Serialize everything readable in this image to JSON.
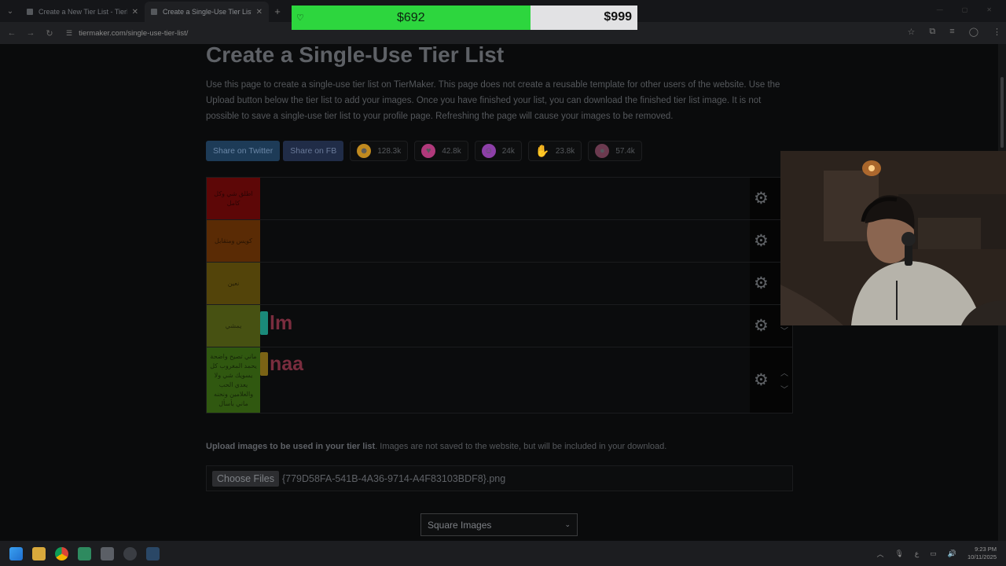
{
  "browser": {
    "tabs": [
      {
        "title": "Create a New Tier List - TierMaker",
        "active": false
      },
      {
        "title": "Create a Single-Use Tier List (F",
        "active": true
      }
    ],
    "url": "tiermaker.com/single-use-tier-list/"
  },
  "donation": {
    "raised": "$692",
    "goal": "$999",
    "progress_fraction": 0.69
  },
  "page": {
    "title": "Create a Single-Use Tier List",
    "intro": "Use this page to create a single-use tier list on TierMaker. This page does not create a reusable template for other users of the website. Use the Upload button below the tier list to add your images. Once you have finished your list, you can download the finished tier list image. It is not possible to save a single-use tier list to your profile page. Refreshing the page will cause your images to be removed.",
    "share": {
      "twitter": "Share on Twitter",
      "fb": "Share on FB"
    },
    "reactions": [
      {
        "icon": "grin-emoji-icon",
        "count": "128.3k",
        "color": "#c08a1f"
      },
      {
        "icon": "heart-eyes-emoji-icon",
        "count": "42.8k",
        "color": "#b0397b"
      },
      {
        "icon": "laughing-emoji-icon",
        "count": "24k",
        "color": "#8d3fa8"
      },
      {
        "icon": "praise-hands-icon",
        "count": "23.8k",
        "color": "#a87620"
      },
      {
        "icon": "poop-emoji-icon",
        "count": "57.4k",
        "color": "#6b3a4f"
      }
    ],
    "tiers": [
      {
        "label": "اطلق شي وكل كامل",
        "color": "#5d0707",
        "height": 54,
        "item": null
      },
      {
        "label": "كويس ومتقابل",
        "color": "#5a2b05",
        "height": 54,
        "item": null
      },
      {
        "label": "نعين",
        "color": "#53440a",
        "height": 54,
        "item": null
      },
      {
        "label": "يمشي",
        "color": "#475112",
        "height": 54,
        "item": "lm"
      },
      {
        "label": "ماني تصيح واضحة يحمد المغروب كل يسويك شي ولا يعدي الحب والعلامين ونحنه ماني بأسأل",
        "color": "#305810",
        "height": 83,
        "item": "naa"
      }
    ],
    "upload": {
      "bold": "Upload images to be used in your tier list",
      "rest": ". Images are not saved to the website, but will be included in your download.",
      "choose_label": "Choose Files",
      "file_name": "{779D58FA-541B-4A36-9714-A4F83103BDF8}.png"
    },
    "select_value": "Square Images"
  },
  "taskbar": {
    "time": "9:23 PM",
    "date": "10/11/2025",
    "lang": "ع"
  }
}
